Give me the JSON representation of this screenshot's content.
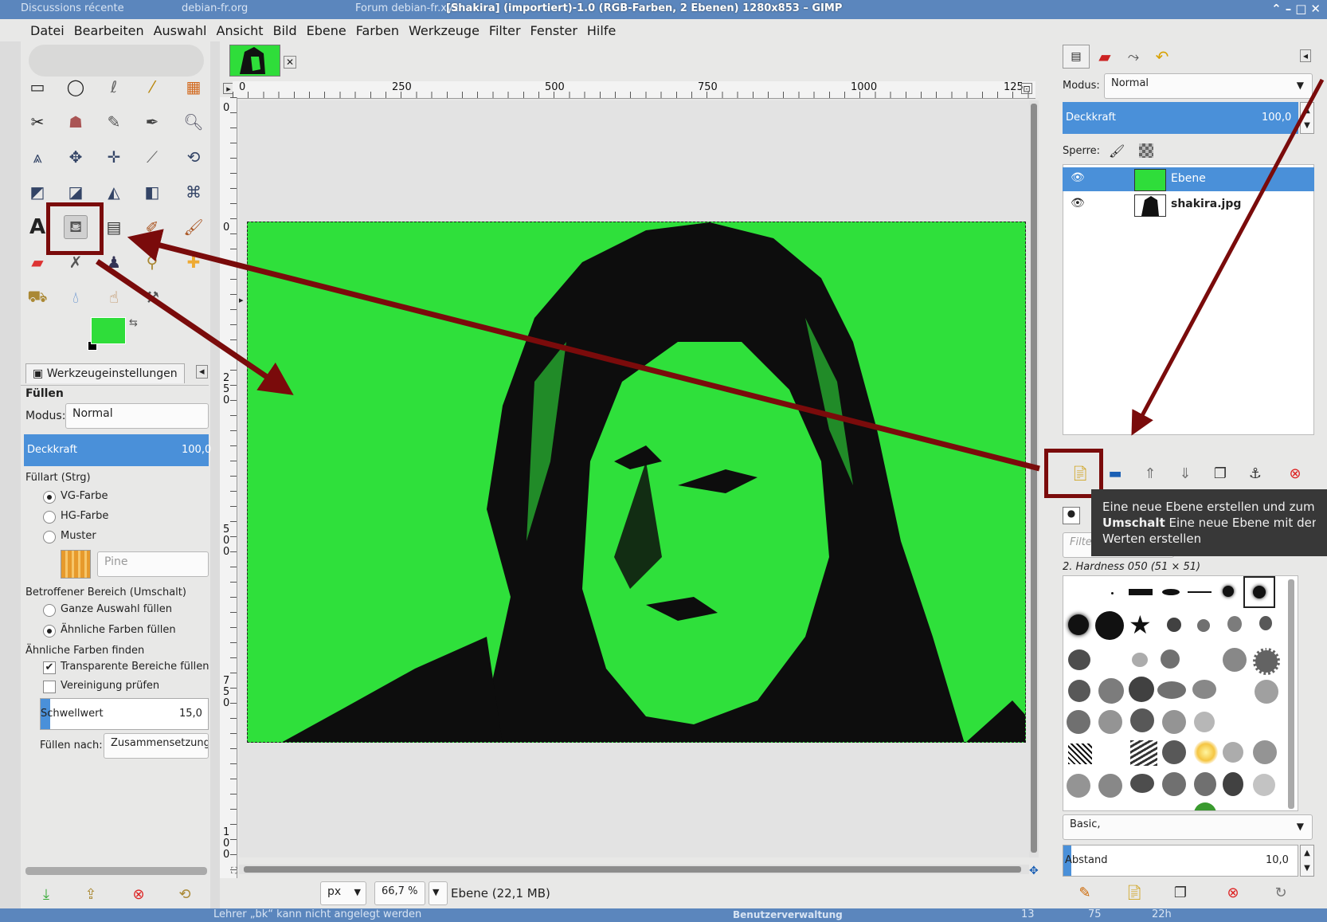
{
  "browser_tabs": [
    {
      "label": "Discussions récente"
    },
    {
      "label": "debian-fr.org"
    },
    {
      "label": "Forum debian-fr.xyz"
    }
  ],
  "window_title": "[Shakira] (importiert)-1.0 (RGB-Farben, 2 Ebenen) 1280x853 – GIMP",
  "menu": [
    "Datei",
    "Bearbeiten",
    "Auswahl",
    "Ansicht",
    "Bild",
    "Ebene",
    "Farben",
    "Werkzeuge",
    "Filter",
    "Fenster",
    "Hilfe"
  ],
  "tool_options": {
    "tab_label": "Werkzeugeinstellungen",
    "heading": "Füllen",
    "mode_label": "Modus:",
    "mode_value": "Normal",
    "opacity_label": "Deckkraft",
    "opacity_value": "100,0",
    "fill_type_label": "Füllart  (Strg)",
    "fill_fg": "VG-Farbe",
    "fill_bg": "HG-Farbe",
    "fill_pattern": "Muster",
    "pattern_name": "Pine",
    "affected_label": "Betroffener Bereich (Umschalt)",
    "affected_whole": "Ganze Auswahl füllen",
    "affected_similar": "Ähnliche Farben füllen",
    "find_similar_label": "Ähnliche Farben finden",
    "transparent_label": "Transparente Bereiche füllen",
    "merged_label": "Vereinigung prüfen",
    "threshold_label": "Schwellwert",
    "threshold_value": "15,0",
    "fill_by_label": "Füllen nach:",
    "fill_by_value": "Zusammensetzung"
  },
  "ruler": {
    "h_ticks": [
      "0",
      "250",
      "500",
      "750",
      "1000",
      "125"
    ],
    "v_ticks": [
      "0",
      "0",
      "250",
      "500",
      "750",
      "100"
    ]
  },
  "status": {
    "unit": "px",
    "zoom": "66,7 %",
    "layer_info": "Ebene (22,1 MB)"
  },
  "layers_panel": {
    "mode_label": "Modus:",
    "mode_value": "Normal",
    "opacity_label": "Deckkraft",
    "opacity_value": "100,0",
    "lock_label": "Sperre:",
    "layers": [
      {
        "name": "Ebene",
        "selected": true
      },
      {
        "name": "shakira.jpg",
        "selected": false
      }
    ]
  },
  "tooltip": {
    "line1": "Eine neue Ebene erstellen und zum Ebe",
    "line2_bold": "Umschalt",
    "line2_rest": "  Eine neue Ebene mit den",
    "line3": "Werten erstellen"
  },
  "brushes": {
    "filter_placeholder": "Filte",
    "current_brush": "2. Hardness 050 (51 × 51)",
    "set": "Basic,",
    "spacing_label": "Abstand",
    "spacing_value": "10,0"
  },
  "taskbar": {
    "text1": "Lehrer „bk“ kann nicht angelegt werden",
    "text2": "Benutzerverwaltung",
    "num1": "13",
    "num2": "75",
    "num3": "22h"
  },
  "colors": {
    "fg": "#2fdd3a",
    "accent": "#4a90d9",
    "annotation": "#7a0b0b"
  }
}
